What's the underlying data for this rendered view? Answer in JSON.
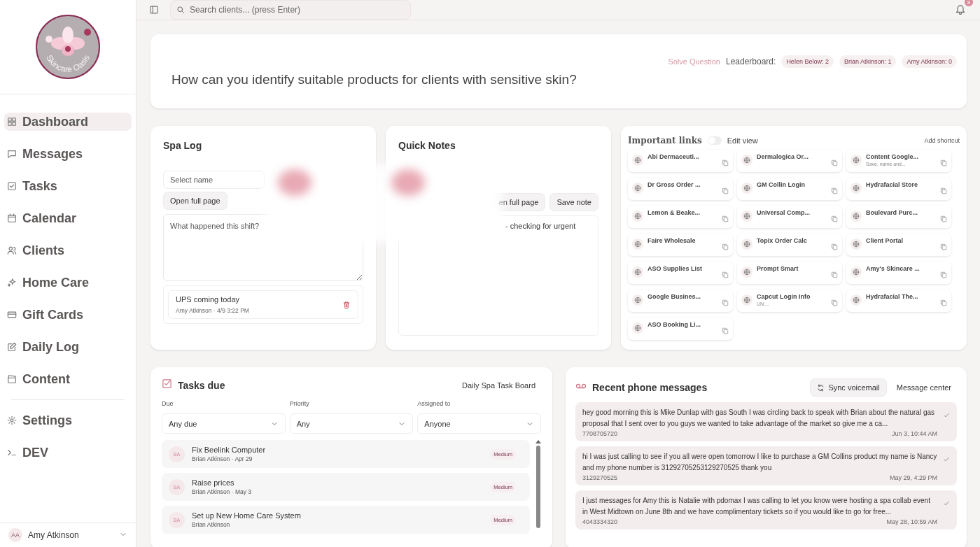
{
  "sidebar": {
    "logo_text": "Skincare Oasis",
    "items": [
      {
        "label": "Dashboard",
        "selected": true
      },
      {
        "label": "Messages",
        "selected": false
      },
      {
        "label": "Tasks",
        "selected": false
      },
      {
        "label": "Calendar",
        "selected": false
      },
      {
        "label": "Clients",
        "selected": false
      },
      {
        "label": "Home Care",
        "selected": false
      },
      {
        "label": "Gift Cards",
        "selected": false
      },
      {
        "label": "Daily Log",
        "selected": false
      },
      {
        "label": "Content",
        "selected": false
      }
    ],
    "bottom_items": [
      {
        "label": "Settings",
        "selected": false
      },
      {
        "label": "DEV",
        "selected": false
      }
    ],
    "user": {
      "initials": "AA",
      "name": "Amy Atkinson"
    }
  },
  "topbar": {
    "search_placeholder": "Search clients... (press Enter)",
    "notification_count": "8"
  },
  "question": {
    "text": "How can you identify suitable products for clients with sensitive skin?",
    "solve": "Solve Question",
    "leaderboard_label": "Leaderboard:",
    "leaders": [
      "Helen Below: 2",
      "Brian Atkinson: 1",
      "Amy Atkinson: 0"
    ]
  },
  "spa_log": {
    "title": "Spa Log",
    "select_placeholder": "Select name",
    "open_button": "Open full page",
    "textarea_placeholder": "What happened this shift?",
    "entries": [
      {
        "text": "UPS coming today",
        "meta": "Amy Atkinson · 4/9 3:22 PM"
      }
    ]
  },
  "quick_notes": {
    "title": "Quick Notes",
    "open_button": "en full page",
    "save_button": "Save note",
    "note_text": "- checking for urgent"
  },
  "links": {
    "title": "Important links",
    "edit_toggle": {
      "label": "Edit view",
      "on": false
    },
    "add_shortcut": "Add shortcut",
    "items": [
      {
        "name": "Abi Dermaceuti..."
      },
      {
        "name": "Dermalogica Or..."
      },
      {
        "name": "Content Google...",
        "note": "Save, name and..."
      },
      {
        "name": "Dr Gross Order ..."
      },
      {
        "name": "GM Collin Login"
      },
      {
        "name": "Hydrafacial Store"
      },
      {
        "name": "Lemon & Beake..."
      },
      {
        "name": "Universal Comp..."
      },
      {
        "name": "Boulevard Purc..."
      },
      {
        "name": "Faire Wholesale"
      },
      {
        "name": "Topix Order Calc"
      },
      {
        "name": "Client Portal"
      },
      {
        "name": "ASO Supplies List"
      },
      {
        "name": "Prompt Smart"
      },
      {
        "name": "Amy's Skincare ..."
      },
      {
        "name": "Google Busines..."
      },
      {
        "name": "Capcut Login Info",
        "note": "UN:..."
      },
      {
        "name": "Hydrafacial The..."
      },
      {
        "name": "ASO Booking Li..."
      }
    ]
  },
  "tasks": {
    "title": "Tasks due",
    "board_link": "Daily Spa Task Board",
    "filters": [
      {
        "label": "Due",
        "value": "Any due"
      },
      {
        "label": "Priority",
        "value": "Any"
      },
      {
        "label": "Assigned to",
        "value": "Anyone"
      }
    ],
    "items": [
      {
        "initials": "BA",
        "title": "Fix Beelink Computer",
        "meta": "Brian Atkinson · Apr 29",
        "priority": "Medium"
      },
      {
        "initials": "BA",
        "title": "Raise prices",
        "meta": "Brian Atkinson · May 3",
        "priority": "Medium"
      },
      {
        "initials": "BA",
        "title": "Set up New Home Care System",
        "meta": "Brian Atkinson",
        "priority": "Medium"
      }
    ]
  },
  "messages": {
    "title": "Recent phone messages",
    "sync_button": "Sync voicemail",
    "center_link": "Message center",
    "items": [
      {
        "text": "hey good morning this is Mike Dunlap with gas South I was circling back to speak with Brian about the natural gas proposal that I sent over to you guys we wanted to take advantage of the market so give me a ca...",
        "phone": "7708705720",
        "time": "Jun 3, 10:44 AM"
      },
      {
        "text": "hi I was just calling to see if you all were open tomorrow I like to purchase a GM Collins product my name is Nancy and my phone number is 31292705253129270525 thank you",
        "phone": "3129270525",
        "time": "May 29, 4:29 PM"
      },
      {
        "text": "I just messages for Amy this is Natalie with pdomax I was calling to let you know were hosting a spa collab event in West Midtown on June 8th and we have complimentary tickets so if you would like to go for free...",
        "phone": "4043334320",
        "time": "May 28, 10:59 AM"
      }
    ]
  }
}
